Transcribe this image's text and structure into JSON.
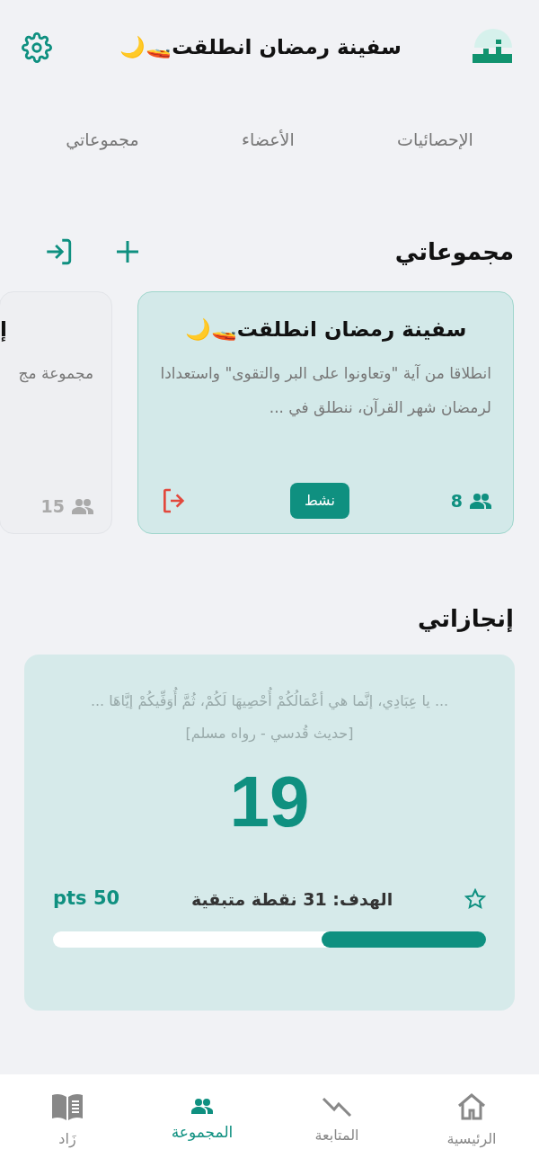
{
  "header": {
    "title": "سفينة رمضان انطلقت🚤🌙"
  },
  "tabs": [
    {
      "label": "الإحصائيات",
      "selected": false
    },
    {
      "label": "الأعضاء",
      "selected": false
    },
    {
      "label": "مجموعاتي",
      "selected": false
    }
  ],
  "groups_section": {
    "title": "مجموعاتي",
    "groups": [
      {
        "title": "سفينة رمضان انطلقت🚤🌙",
        "description": "انطلاقا من آية \"وتعاونوا على البر والتقوى\" واستعدادا لرمضان شهر القرآن، ننطلق في ...",
        "members": "8",
        "status": "نشط",
        "selected": true
      },
      {
        "title": "إ",
        "description": "مجموعة مج",
        "members": "15",
        "selected": false
      }
    ]
  },
  "achievements": {
    "title": "إنجازاتي",
    "quote": "... يا عِبَادِي، إنَّما هي أعْمَالُكُمْ أُحْصِيهَا لَكُمْ، ثُمَّ أُوَفِّيكُمْ إيَّاهَا ...",
    "source": "[حديث قُدسي - رواه مسلم]",
    "points": "19",
    "goal": "الهدف: 31 نقطة متبقية",
    "target": "pts 50",
    "level": 0.38
  },
  "bottom_nav": [
    {
      "label": "الرئيسية",
      "selected": false
    },
    {
      "label": "المتابعة",
      "selected": false
    },
    {
      "label": "المجموعة",
      "selected": true
    },
    {
      "label": "زَاد",
      "selected": false
    }
  ]
}
